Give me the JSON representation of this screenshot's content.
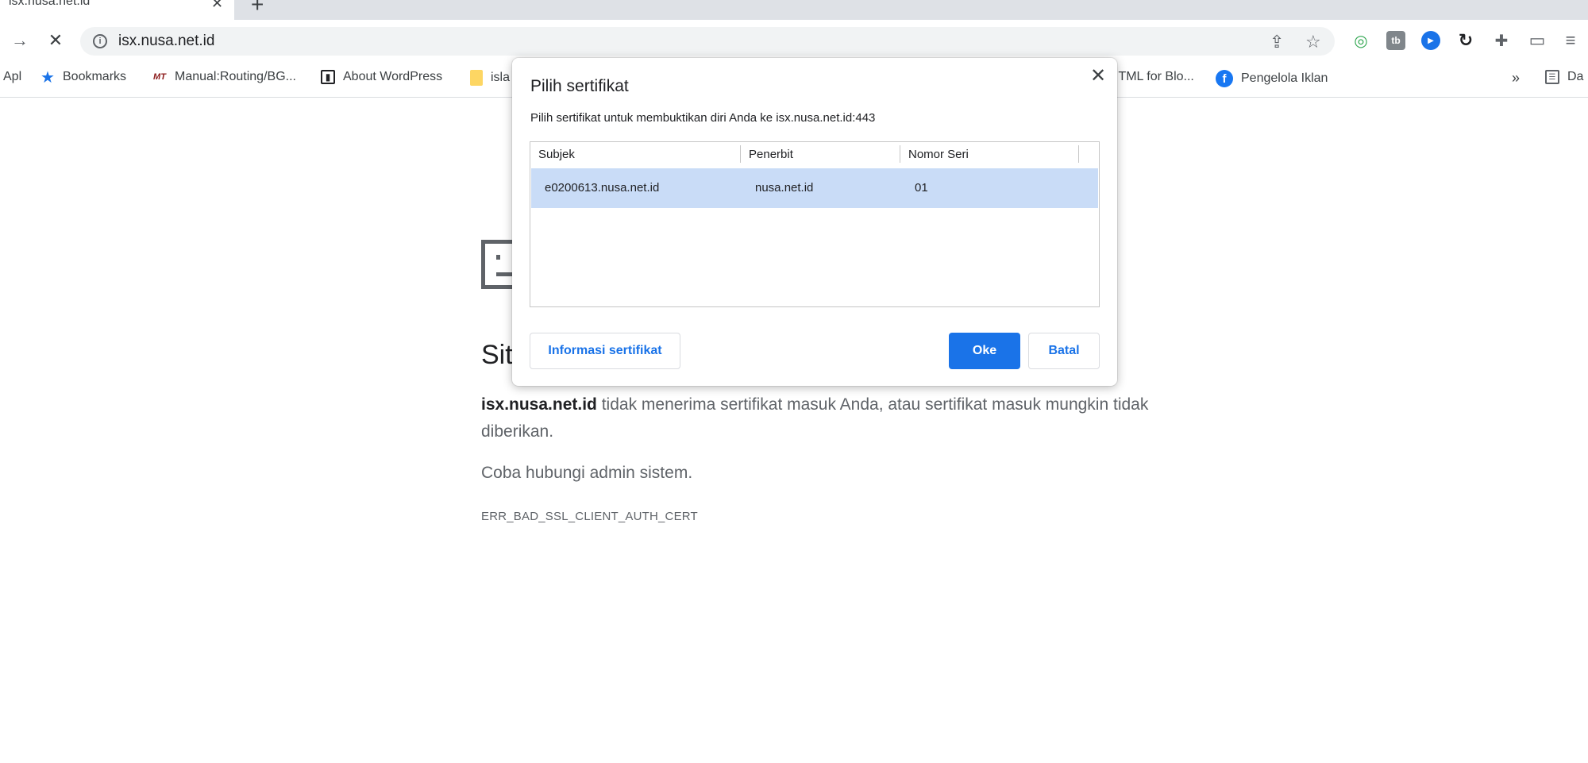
{
  "tab": {
    "title": "isx.nusa.net.id",
    "close_glyph": "✕",
    "new_tab_glyph": "+"
  },
  "toolbar": {
    "forward_glyph": "→",
    "stop_glyph": "✕",
    "url": "isx.nusa.net.id",
    "share_glyph": "⇪",
    "star_glyph": "☆",
    "extensions": [
      {
        "name": "ext-1",
        "glyph": "◎",
        "color": "#34a853"
      },
      {
        "name": "ext-2",
        "glyph": "tb",
        "color": "#5f6368"
      },
      {
        "name": "ext-3",
        "glyph": "▶",
        "color": "#1a73e8"
      },
      {
        "name": "ext-4",
        "glyph": "↻",
        "color": "#202124"
      },
      {
        "name": "extensions-puzzle",
        "glyph": "✚",
        "color": "#5f6368"
      }
    ],
    "cast_glyph": "▭",
    "media_glyph": "≡"
  },
  "bookmarks": {
    "items": [
      {
        "label": "Apl",
        "icon": "apps-icon"
      },
      {
        "label": "Bookmarks",
        "icon": "star-icon"
      },
      {
        "label": "Manual:Routing/BG...",
        "icon": "mikrotik-icon"
      },
      {
        "label": "About WordPress",
        "icon": "wordpress-icon"
      },
      {
        "label": "isla",
        "icon": "folder-icon"
      },
      {
        "label": "ITML for Blo...",
        "icon": ""
      },
      {
        "label": "Pengelola Iklan",
        "icon": "facebook-icon"
      }
    ],
    "overflow": "»",
    "reading_list": "Da"
  },
  "page": {
    "title": "Sit",
    "host_bold": "isx.nusa.net.id",
    "description": " tidak menerima sertifikat masuk Anda, atau sertifikat masuk mungkin tidak diberikan.",
    "hint": "Coba hubungi admin sistem.",
    "error_code": "ERR_BAD_SSL_CLIENT_AUTH_CERT"
  },
  "dialog": {
    "title": "Pilih sertifikat",
    "subtitle": "Pilih sertifikat untuk membuktikan diri Anda ke isx.nusa.net.id:443",
    "close_glyph": "✕",
    "columns": [
      "Subjek",
      "Penerbit",
      "Nomor Seri"
    ],
    "rows": [
      {
        "subject": "e0200613.nusa.net.id",
        "issuer": "nusa.net.id",
        "serial": "01",
        "selected": true
      }
    ],
    "info_button": "Informasi sertifikat",
    "ok_button": "Oke",
    "cancel_button": "Batal",
    "selected_row_color": "#c9dcf7",
    "accent": "#1a73e8"
  }
}
